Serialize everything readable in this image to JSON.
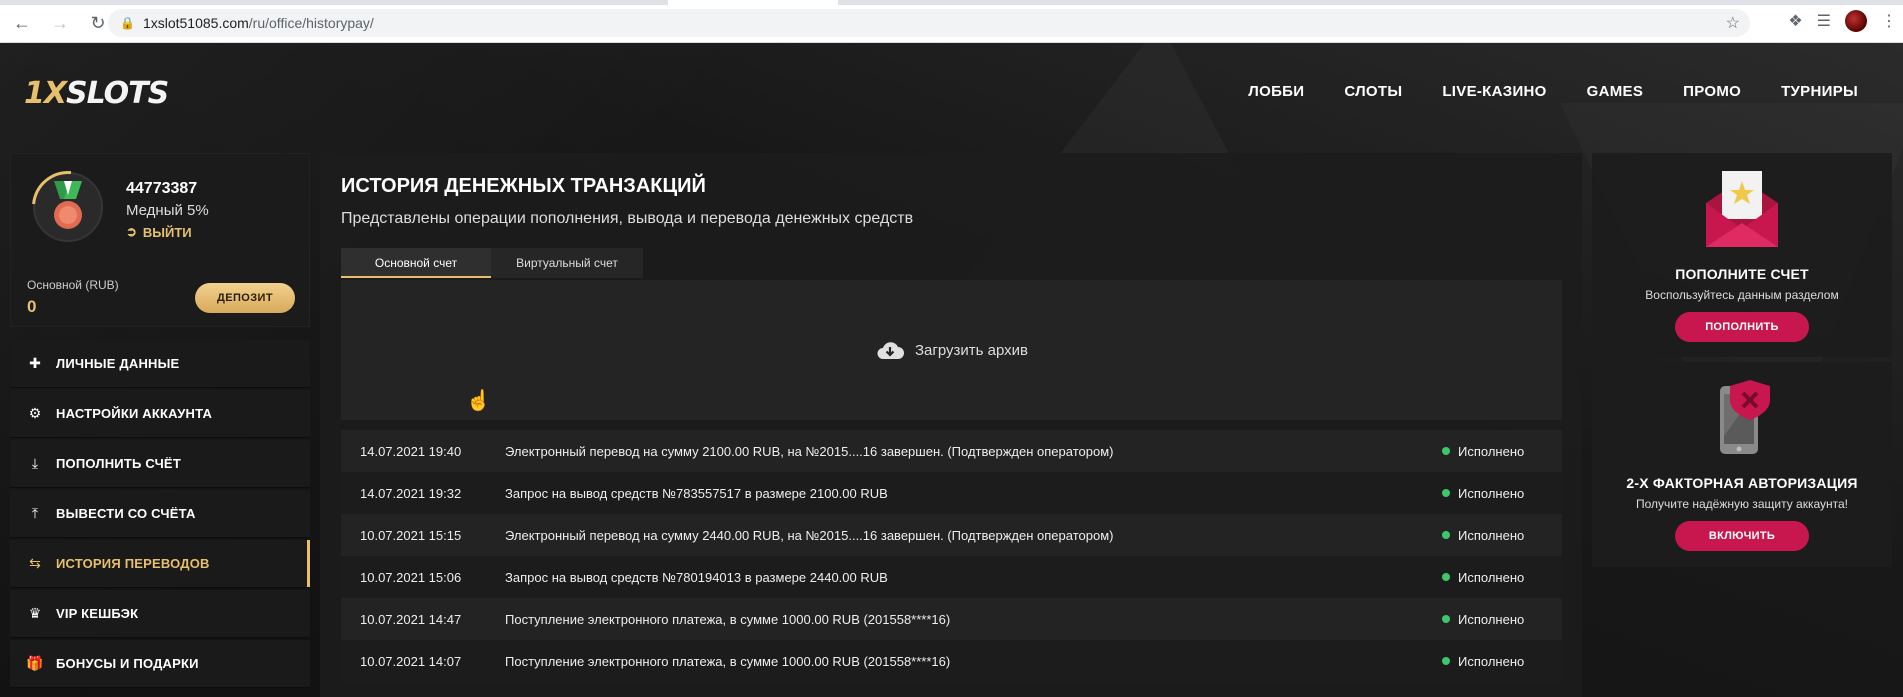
{
  "browser": {
    "url_host": "1xslot51085.com",
    "url_path": "/ru/office/historypay/"
  },
  "header": {
    "logo_part1": "1X",
    "logo_part2": "SLOTS",
    "nav": [
      "ЛОББИ",
      "СЛОТЫ",
      "LIVE-КАЗИНО",
      "GAMES",
      "ПРОМО",
      "ТУРНИРЫ"
    ]
  },
  "profile": {
    "user_id": "44773387",
    "level": "Медный 5%",
    "logout": "ВЫЙТИ",
    "balance_label": "Основной (RUB)",
    "balance_value": "0",
    "deposit_label": "ДЕПОЗИТ"
  },
  "sidebar": {
    "items": [
      {
        "label": "ЛИЧНЫЕ ДАННЫЕ",
        "icon": "user-add-icon"
      },
      {
        "label": "НАСТРОЙКИ АККАУНТА",
        "icon": "gears-icon"
      },
      {
        "label": "ПОПОЛНИТЬ СЧЁТ",
        "icon": "download-icon"
      },
      {
        "label": "ВЫВЕСТИ СО СЧЁТА",
        "icon": "upload-icon"
      },
      {
        "label": "ИСТОРИЯ ПЕРЕВОДОВ",
        "icon": "transfer-arrows-icon"
      },
      {
        "label": "VIP КЕШБЭК",
        "icon": "crown-icon"
      },
      {
        "label": "БОНУСЫ И ПОДАРКИ",
        "icon": "gift-icon"
      }
    ],
    "active_index": 4
  },
  "main": {
    "title": "ИСТОРИЯ ДЕНЕЖНЫХ ТРАНЗАКЦИЙ",
    "subtitle": "Представлены операции пополнения, вывода и перевода денежных средств",
    "tabs": [
      "Основной счет",
      "Виртуальный счет"
    ],
    "archive_label": "Загрузить архив",
    "transactions": [
      {
        "date": "14.07.2021 19:40",
        "desc": "Электронный перевод на сумму 2100.00 RUB, на №2015....16 завершен. (Подтвержден оператором)",
        "status": "Исполнено"
      },
      {
        "date": "14.07.2021 19:32",
        "desc": "Запрос на вывод средств №783557517 в размере 2100.00 RUB",
        "status": "Исполнено"
      },
      {
        "date": "10.07.2021 15:15",
        "desc": "Электронный перевод на сумму 2440.00 RUB, на №2015....16 завершен. (Подтвержден оператором)",
        "status": "Исполнено"
      },
      {
        "date": "10.07.2021 15:06",
        "desc": "Запрос на вывод средств №780194013 в размере 2440.00 RUB",
        "status": "Исполнено"
      },
      {
        "date": "10.07.2021 14:47",
        "desc": "Поступление электронного платежа, в сумме 1000.00 RUB (201558****16)",
        "status": "Исполнено"
      },
      {
        "date": "10.07.2021 14:07",
        "desc": "Поступление электронного платежа, в сумме 1000.00 RUB (201558****16)",
        "status": "Исполнено"
      }
    ]
  },
  "promos": [
    {
      "title": "ПОПОЛНИТЕ СЧЕТ",
      "text": "Воспользуйтесь данным разделом",
      "button": "ПОПОЛНИТЬ",
      "icon": "envelope-star-icon"
    },
    {
      "title": "2-Х ФАКТОРНАЯ АВТОРИЗАЦИЯ",
      "text": "Получите надёжную защиту аккаунта!",
      "button": "ВКЛЮЧИТЬ",
      "icon": "phone-shield-icon"
    }
  ],
  "colors": {
    "accent_gold": "#e8c06c",
    "promo_button": "#c8174e",
    "status_dot": "#3ec66a"
  }
}
